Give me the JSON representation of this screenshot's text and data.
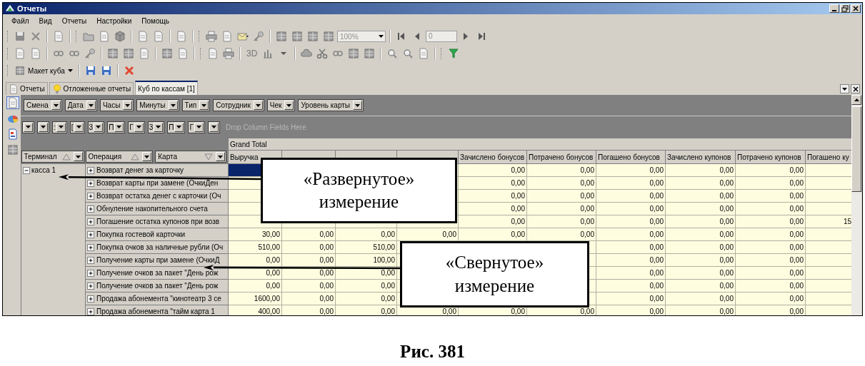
{
  "window": {
    "title": "Отчеты"
  },
  "menu": [
    "Файл",
    "Вид",
    "Отчеты",
    "Настройки",
    "Помощь"
  ],
  "toolbar": {
    "zoom": "100%",
    "page": "0",
    "view_3d": "3D",
    "cube_layout": "Макет куба"
  },
  "tabs": [
    {
      "label": "Отчеты",
      "selected": false
    },
    {
      "label": "Отложенные отчеты",
      "selected": false
    },
    {
      "label": "Куб по кассам [1]",
      "selected": true
    }
  ],
  "pivot": {
    "filter_fields": [
      {
        "label": "Смена"
      },
      {
        "label": "Дата"
      },
      {
        "label": "Часы"
      },
      {
        "label": "Минуты"
      },
      {
        "label": "Тип"
      },
      {
        "label": "Сотрудник"
      },
      {
        "label": "Чек"
      },
      {
        "label": "Уровень карты"
      }
    ],
    "column_fields": [
      {
        "kind": "blank"
      },
      {
        "kind": "blank"
      },
      {
        "kind": "labeled",
        "label": ":"
      },
      {
        "kind": "labeled",
        "label": "["
      },
      {
        "kind": "labeled",
        "label": "3"
      },
      {
        "kind": "labeled",
        "label": "П"
      },
      {
        "kind": "labeled",
        "label": "Г"
      },
      {
        "kind": "labeled",
        "label": "3"
      },
      {
        "kind": "labeled",
        "label": "П"
      },
      {
        "kind": "labeled",
        "label": "Г"
      },
      {
        "kind": "blank"
      }
    ],
    "drop_hint": "Drop Column Fields Here",
    "grand_total": "Grand Total",
    "row_fields": [
      {
        "label": "Терминал",
        "descending": false
      },
      {
        "label": "Операция",
        "descending": false
      },
      {
        "label": "Карта",
        "descending": true
      }
    ],
    "columns": {
      "column_1": "Выручка",
      "column_5": "Зачислено бонусов",
      "column_6": "Потрачено бонусов",
      "column_7": "Погашено бонусов",
      "column_8": "Зачислено купонов",
      "column_9": "Потрачено купонов",
      "column_10": "Погашено ку"
    },
    "groups": [
      {
        "label": "касса 1",
        "expanded": true,
        "rows": [
          {
            "label": "Возврат денег за карточку",
            "expanded": false,
            "selected": true,
            "values": {
              "column_5": "0,00",
              "column_6": "0,00",
              "column_7": "0,00",
              "column_8": "0,00",
              "column_9": "0,00"
            }
          },
          {
            "label": "Возврат карты при замене (ОчкиДен",
            "expanded": false,
            "selected": false,
            "values": {
              "column_5": "0,00",
              "column_6": "0,00",
              "column_7": "0,00",
              "column_8": "0,00",
              "column_9": "0,00"
            }
          },
          {
            "label": "Возврат остатка денег с карточки (Оч",
            "expanded": false,
            "selected": false,
            "values": {
              "column_5": "0,00",
              "column_6": "0,00",
              "column_7": "0,00",
              "column_8": "0,00",
              "column_9": "0,00"
            }
          },
          {
            "label": "Обнуление накопительного счета",
            "expanded": false,
            "selected": false,
            "values": {
              "column_5": "0,00",
              "column_6": "0,00",
              "column_7": "0,00",
              "column_8": "0,00",
              "column_9": "0,00"
            }
          },
          {
            "label": "Погашение остатка купонов при возв",
            "expanded": false,
            "selected": false,
            "values": {
              "column_5": "0,00",
              "column_6": "0,00",
              "column_7": "0,00",
              "column_8": "0,00",
              "column_9": "0,00",
              "column_10": "15"
            }
          },
          {
            "label": "Покупка гостевой карточки",
            "expanded": false,
            "selected": false,
            "values": {
              "column_1": "30,00",
              "column_2": "0,00",
              "column_3": "0,00",
              "column_4": "0,00",
              "column_5": "0,00",
              "column_6": "0,00",
              "column_7": "0,00",
              "column_8": "0,00",
              "column_9": "0,00"
            }
          },
          {
            "label": "Покупка очков за наличные рубли (Оч",
            "expanded": false,
            "selected": false,
            "values": {
              "column_1": "510,00",
              "column_2": "0,00",
              "column_3": "510,00",
              "column_7": "0,00",
              "column_8": "0,00",
              "column_9": "0,00"
            }
          },
          {
            "label": "Получение карты при замене (ОчкиД",
            "expanded": false,
            "selected": false,
            "values": {
              "column_1": "0,00",
              "column_2": "0,00",
              "column_3": "100,00",
              "column_7": "0,00",
              "column_8": "0,00",
              "column_9": "0,00"
            }
          },
          {
            "label": "Получение очков за пакет \"День рож",
            "expanded": false,
            "selected": false,
            "values": {
              "column_1": "0,00",
              "column_2": "0,00",
              "column_3": "0,00",
              "column_7": "0,00",
              "column_8": "0,00",
              "column_9": "0,00"
            }
          },
          {
            "label": "Получение очков за пакет \"День рож",
            "expanded": false,
            "selected": false,
            "values": {
              "column_1": "0,00",
              "column_2": "0,00",
              "column_3": "0,00",
              "column_7": "0,00",
              "column_8": "0,00",
              "column_9": "0,00"
            }
          },
          {
            "label": "Продажа абонемента \"кинотеатр 3 се",
            "expanded": false,
            "selected": false,
            "values": {
              "column_1": "1600,00",
              "column_2": "0,00",
              "column_3": "0,00",
              "column_7": "0,00",
              "column_8": "0,00",
              "column_9": "0,00"
            }
          },
          {
            "label": "Продажа абонемента \"тайм карта  1",
            "expanded": false,
            "selected": false,
            "values": {
              "column_1": "400,00",
              "column_2": "0,00",
              "column_3": "0,00",
              "column_4": "0,00",
              "column_5": "0,00",
              "column_6": "0,00",
              "column_7": "0,00",
              "column_8": "0,00",
              "column_9": "0,00"
            }
          }
        ]
      }
    ]
  },
  "callouts": [
    {
      "text": "«Развернутое» измерение"
    },
    {
      "text": "«Свернутое» измерение"
    }
  ],
  "caption": "Рис. 381"
}
